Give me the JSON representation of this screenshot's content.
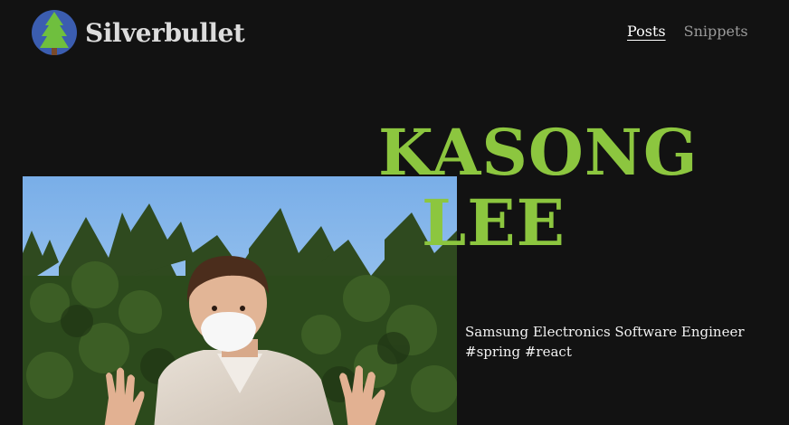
{
  "header": {
    "brand": "Silverbullet",
    "logo_icon": "tree-icon",
    "nav": [
      {
        "label": "Posts",
        "active": true
      },
      {
        "label": "Snippets",
        "active": false
      }
    ]
  },
  "hero": {
    "name_line1": "KASONG",
    "name_line2": "LEE",
    "description_line1": "Samsung Electronics Software Engineer",
    "description_line2": "#spring #react",
    "photo_icon": "profile-photo"
  },
  "colors": {
    "background": "#121212",
    "accent": "#8cc63f",
    "logo_circle": "#3b5db0",
    "logo_tree": "#6fbf3e"
  }
}
